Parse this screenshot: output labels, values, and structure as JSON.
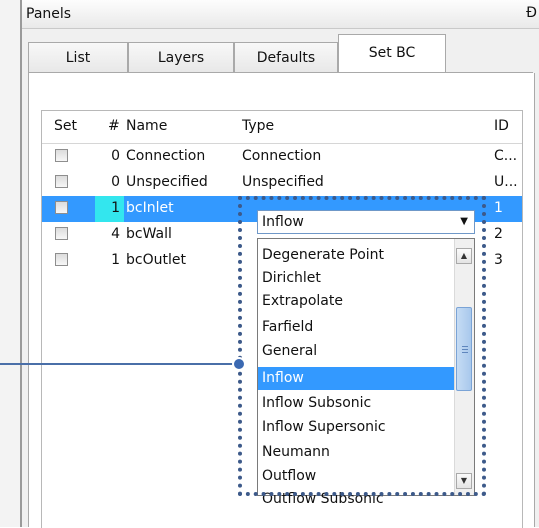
{
  "panel": {
    "title": "Panels",
    "pin_icon": "Ɖ"
  },
  "tabs": [
    {
      "label": "List"
    },
    {
      "label": "Layers"
    },
    {
      "label": "Defaults"
    },
    {
      "label": "Set BC",
      "active": true
    }
  ],
  "grid": {
    "headers": {
      "set": "Set",
      "num": "#",
      "name": "Name",
      "type": "Type",
      "id": "ID"
    },
    "rows": [
      {
        "num": "0",
        "name": "Connection",
        "type": "Connection",
        "id": "C..."
      },
      {
        "num": "0",
        "name": "Unspecified",
        "type": "Unspecified",
        "id": "U..."
      },
      {
        "num": "1",
        "name": "bcInlet",
        "type": "Inflow",
        "id": "1",
        "selected": true
      },
      {
        "num": "4",
        "name": "bcWall",
        "type": "",
        "id": "2"
      },
      {
        "num": "1",
        "name": "bcOutlet",
        "type": "",
        "id": "3"
      }
    ]
  },
  "combo": {
    "value": "Inflow",
    "arrow": "▼"
  },
  "dropdown": {
    "options": [
      "Degenerate Point",
      "Dirichlet",
      "Extrapolate",
      "Farfield",
      "General",
      "Inflow",
      "Inflow Subsonic",
      "Inflow Supersonic",
      "Neumann",
      "Outflow",
      "Outflow Subsonic"
    ],
    "selected": "Inflow",
    "scroll_up": "▲",
    "scroll_down": "▼"
  },
  "colors": {
    "selection": "#3399ff",
    "num_highlight": "#33e6ee",
    "callout": "#3d5a8a"
  }
}
